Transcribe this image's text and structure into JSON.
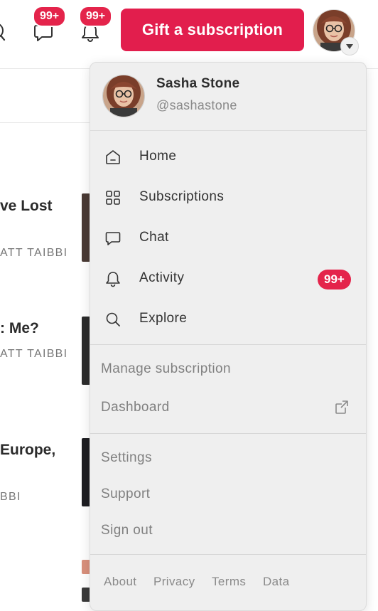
{
  "header": {
    "messages_badge": "99+",
    "notifications_badge": "99+",
    "gift_button_label": "Gift a subscription"
  },
  "feed": {
    "items": [
      {
        "title_fragment": "ve Lost",
        "author_fragment": "ATT TAIBBI"
      },
      {
        "title_fragment": ": Me?",
        "author_fragment": "ATT TAIBBI"
      },
      {
        "title_fragment": "Europe,",
        "author_fragment": "BBI"
      }
    ]
  },
  "menu": {
    "profile": {
      "name": "Sasha Stone",
      "handle": "@sashastone"
    },
    "primary_items": [
      {
        "label": "Home",
        "icon": "home-icon"
      },
      {
        "label": "Subscriptions",
        "icon": "grid-icon"
      },
      {
        "label": "Chat",
        "icon": "chat-icon"
      },
      {
        "label": "Activity",
        "icon": "bell-icon",
        "badge": "99+"
      },
      {
        "label": "Explore",
        "icon": "search-icon"
      }
    ],
    "manage_items": [
      {
        "label": "Manage subscription"
      },
      {
        "label": "Dashboard",
        "icon": "external-link-icon"
      }
    ],
    "account_items": [
      {
        "label": "Settings"
      },
      {
        "label": "Support"
      },
      {
        "label": "Sign out"
      }
    ],
    "footer_links": [
      "About",
      "Privacy",
      "Terms",
      "Data"
    ]
  },
  "colors": {
    "accent": "#e21e4d",
    "badge": "#e4244b",
    "menu_background": "#efefef"
  }
}
